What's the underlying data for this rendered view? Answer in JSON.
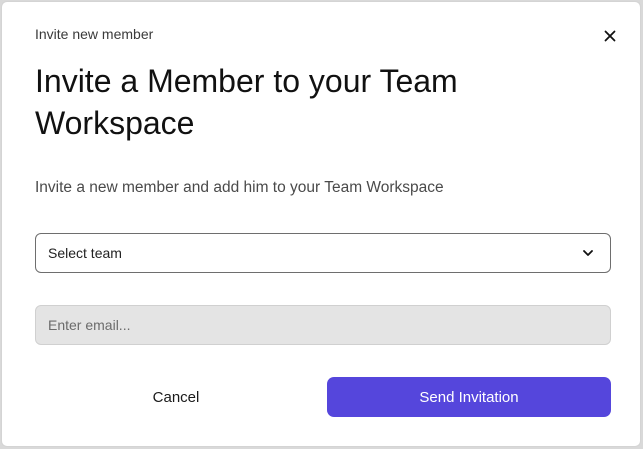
{
  "modal": {
    "header_label": "Invite new member",
    "title": "Invite a Member to your Team Workspace",
    "description": "Invite a new member and add him to your Team Workspace",
    "close_icon": "close-icon"
  },
  "team_select": {
    "value": "Select team",
    "icon": "chevron-down-icon"
  },
  "email": {
    "placeholder": "Enter email...",
    "value": ""
  },
  "actions": {
    "cancel_label": "Cancel",
    "send_label": "Send Invitation"
  },
  "colors": {
    "primary": "#5546dc",
    "input_disabled_bg": "#e4e4e4"
  }
}
